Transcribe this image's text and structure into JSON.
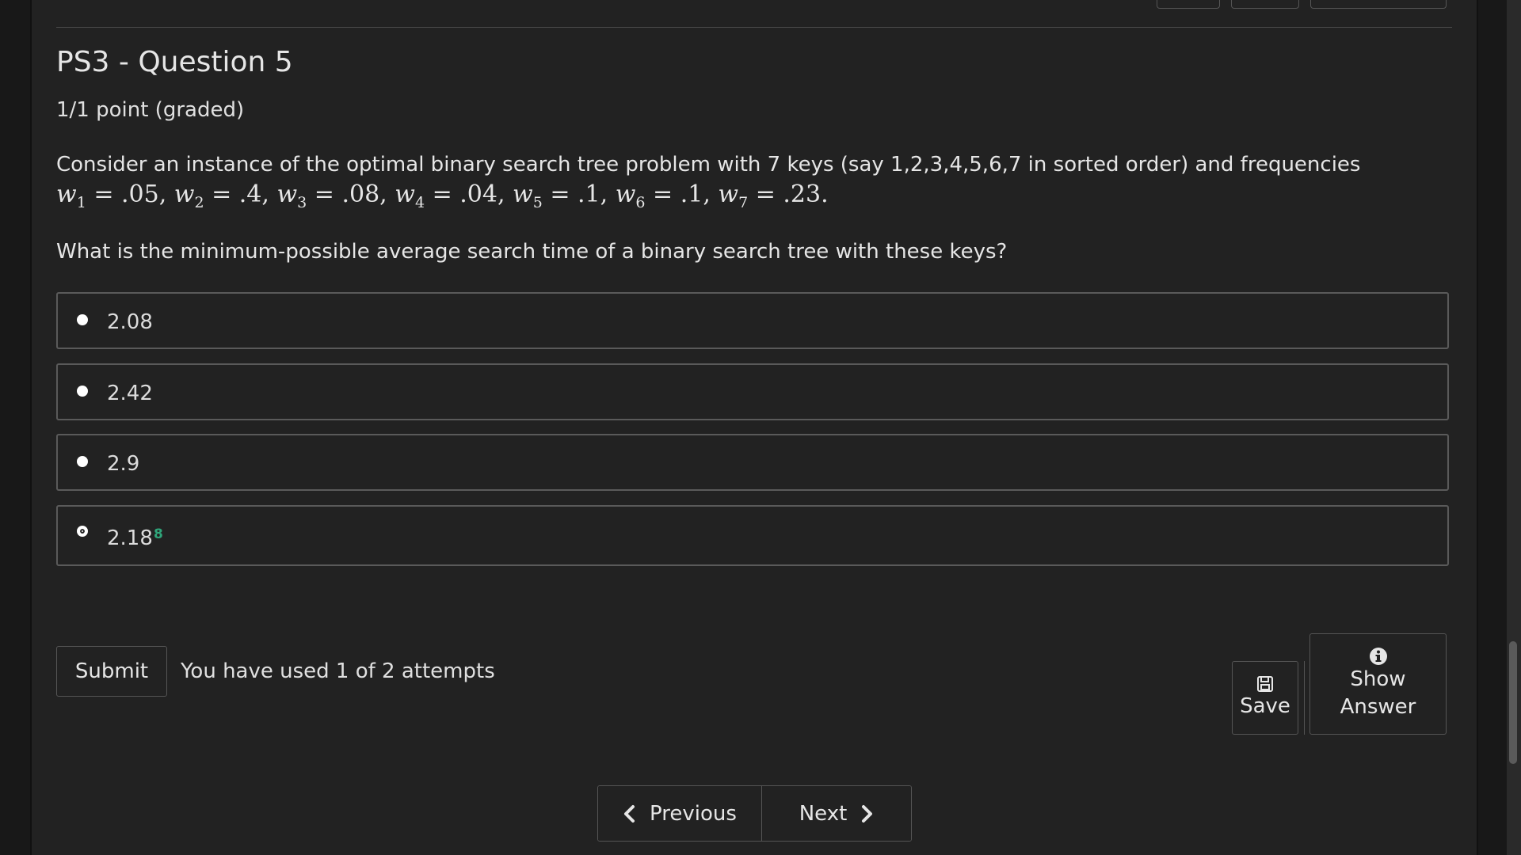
{
  "problem": {
    "title": "PS3 - Question 5",
    "points": "1/1 point (graded)",
    "prompt": "Consider an instance of the optimal binary search tree problem with 7 keys (say 1,2,3,4,5,6,7 in sorted order) and frequencies",
    "formula": [
      {
        "w": "w",
        "sub": "1",
        "val": " = .05, "
      },
      {
        "w": "w",
        "sub": "2",
        "val": " = .4, "
      },
      {
        "w": "w",
        "sub": "3",
        "val": " = .08, "
      },
      {
        "w": "w",
        "sub": "4",
        "val": " = .04, "
      },
      {
        "w": "w",
        "sub": "5",
        "val": " = .1, "
      },
      {
        "w": "w",
        "sub": "6",
        "val": " = .1, "
      },
      {
        "w": "w",
        "sub": "7",
        "val": " = .23."
      }
    ],
    "question": "What is the minimum-possible average search time of a binary search tree with these keys?",
    "choices": [
      {
        "label": "2.08",
        "selected": false
      },
      {
        "label": "2.42",
        "selected": false
      },
      {
        "label": "2.9",
        "selected": false
      },
      {
        "label": "2.18",
        "selected": true,
        "mark": "8"
      }
    ]
  },
  "actions": {
    "submit_label": "Submit",
    "attempts_text": "You have used 1 of 2 attempts",
    "save_label": "Save",
    "show_answer_label_1": "Show",
    "show_answer_label_2": "Answer"
  },
  "navigation": {
    "previous_label": "Previous",
    "next_label": "Next"
  },
  "icons": {
    "save": "floppy-disk-icon",
    "show_answer": "info-circle-icon",
    "previous": "chevron-left-icon",
    "next": "chevron-right-icon"
  },
  "colors": {
    "background": "#222222",
    "correct_mark": "#2fa57a",
    "border": "#5a5a5a"
  }
}
